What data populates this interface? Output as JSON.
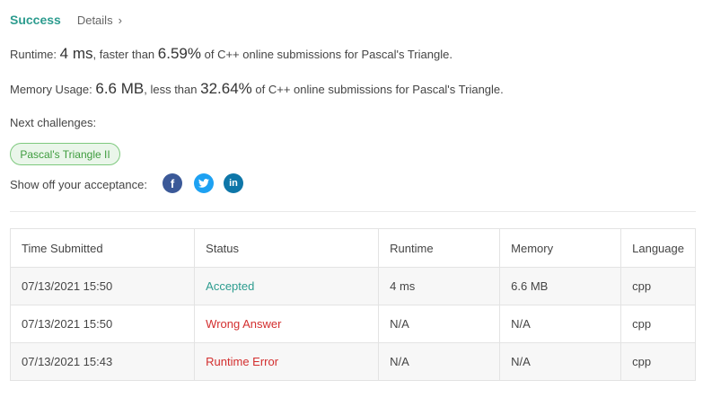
{
  "header": {
    "status": "Success",
    "details_label": "Details",
    "details_chevron": "›"
  },
  "runtime": {
    "label": "Runtime:",
    "value": "4 ms",
    "mid": ", faster than",
    "percent": "6.59%",
    "suffix": "of C++ online submissions for Pascal's Triangle."
  },
  "memory": {
    "label": "Memory Usage:",
    "value": "6.6 MB",
    "mid": ", less than",
    "percent": "32.64%",
    "suffix": "of C++ online submissions for Pascal's Triangle."
  },
  "next": {
    "label": "Next challenges:",
    "challenge": "Pascal's Triangle II"
  },
  "share": {
    "label": "Show off your acceptance:",
    "facebook_glyph": "f",
    "twitter_glyph": "t",
    "linkedin_glyph": "in",
    "icons": [
      "facebook-icon",
      "twitter-icon",
      "linkedin-icon"
    ]
  },
  "table": {
    "headers": [
      "Time Submitted",
      "Status",
      "Runtime",
      "Memory",
      "Language"
    ],
    "rows": [
      {
        "time": "07/13/2021 15:50",
        "status": "Accepted",
        "runtime": "4 ms",
        "memory": "6.6 MB",
        "language": "cpp"
      },
      {
        "time": "07/13/2021 15:50",
        "status": "Wrong Answer",
        "runtime": "N/A",
        "memory": "N/A",
        "language": "cpp"
      },
      {
        "time": "07/13/2021 15:43",
        "status": "Runtime Error",
        "runtime": "N/A",
        "memory": "N/A",
        "language": "cpp"
      }
    ]
  },
  "colors": {
    "success": "#2d9c8f",
    "error": "#d32f2f",
    "chip_border": "#7ec97e",
    "chip_text": "#3e9c3e"
  }
}
